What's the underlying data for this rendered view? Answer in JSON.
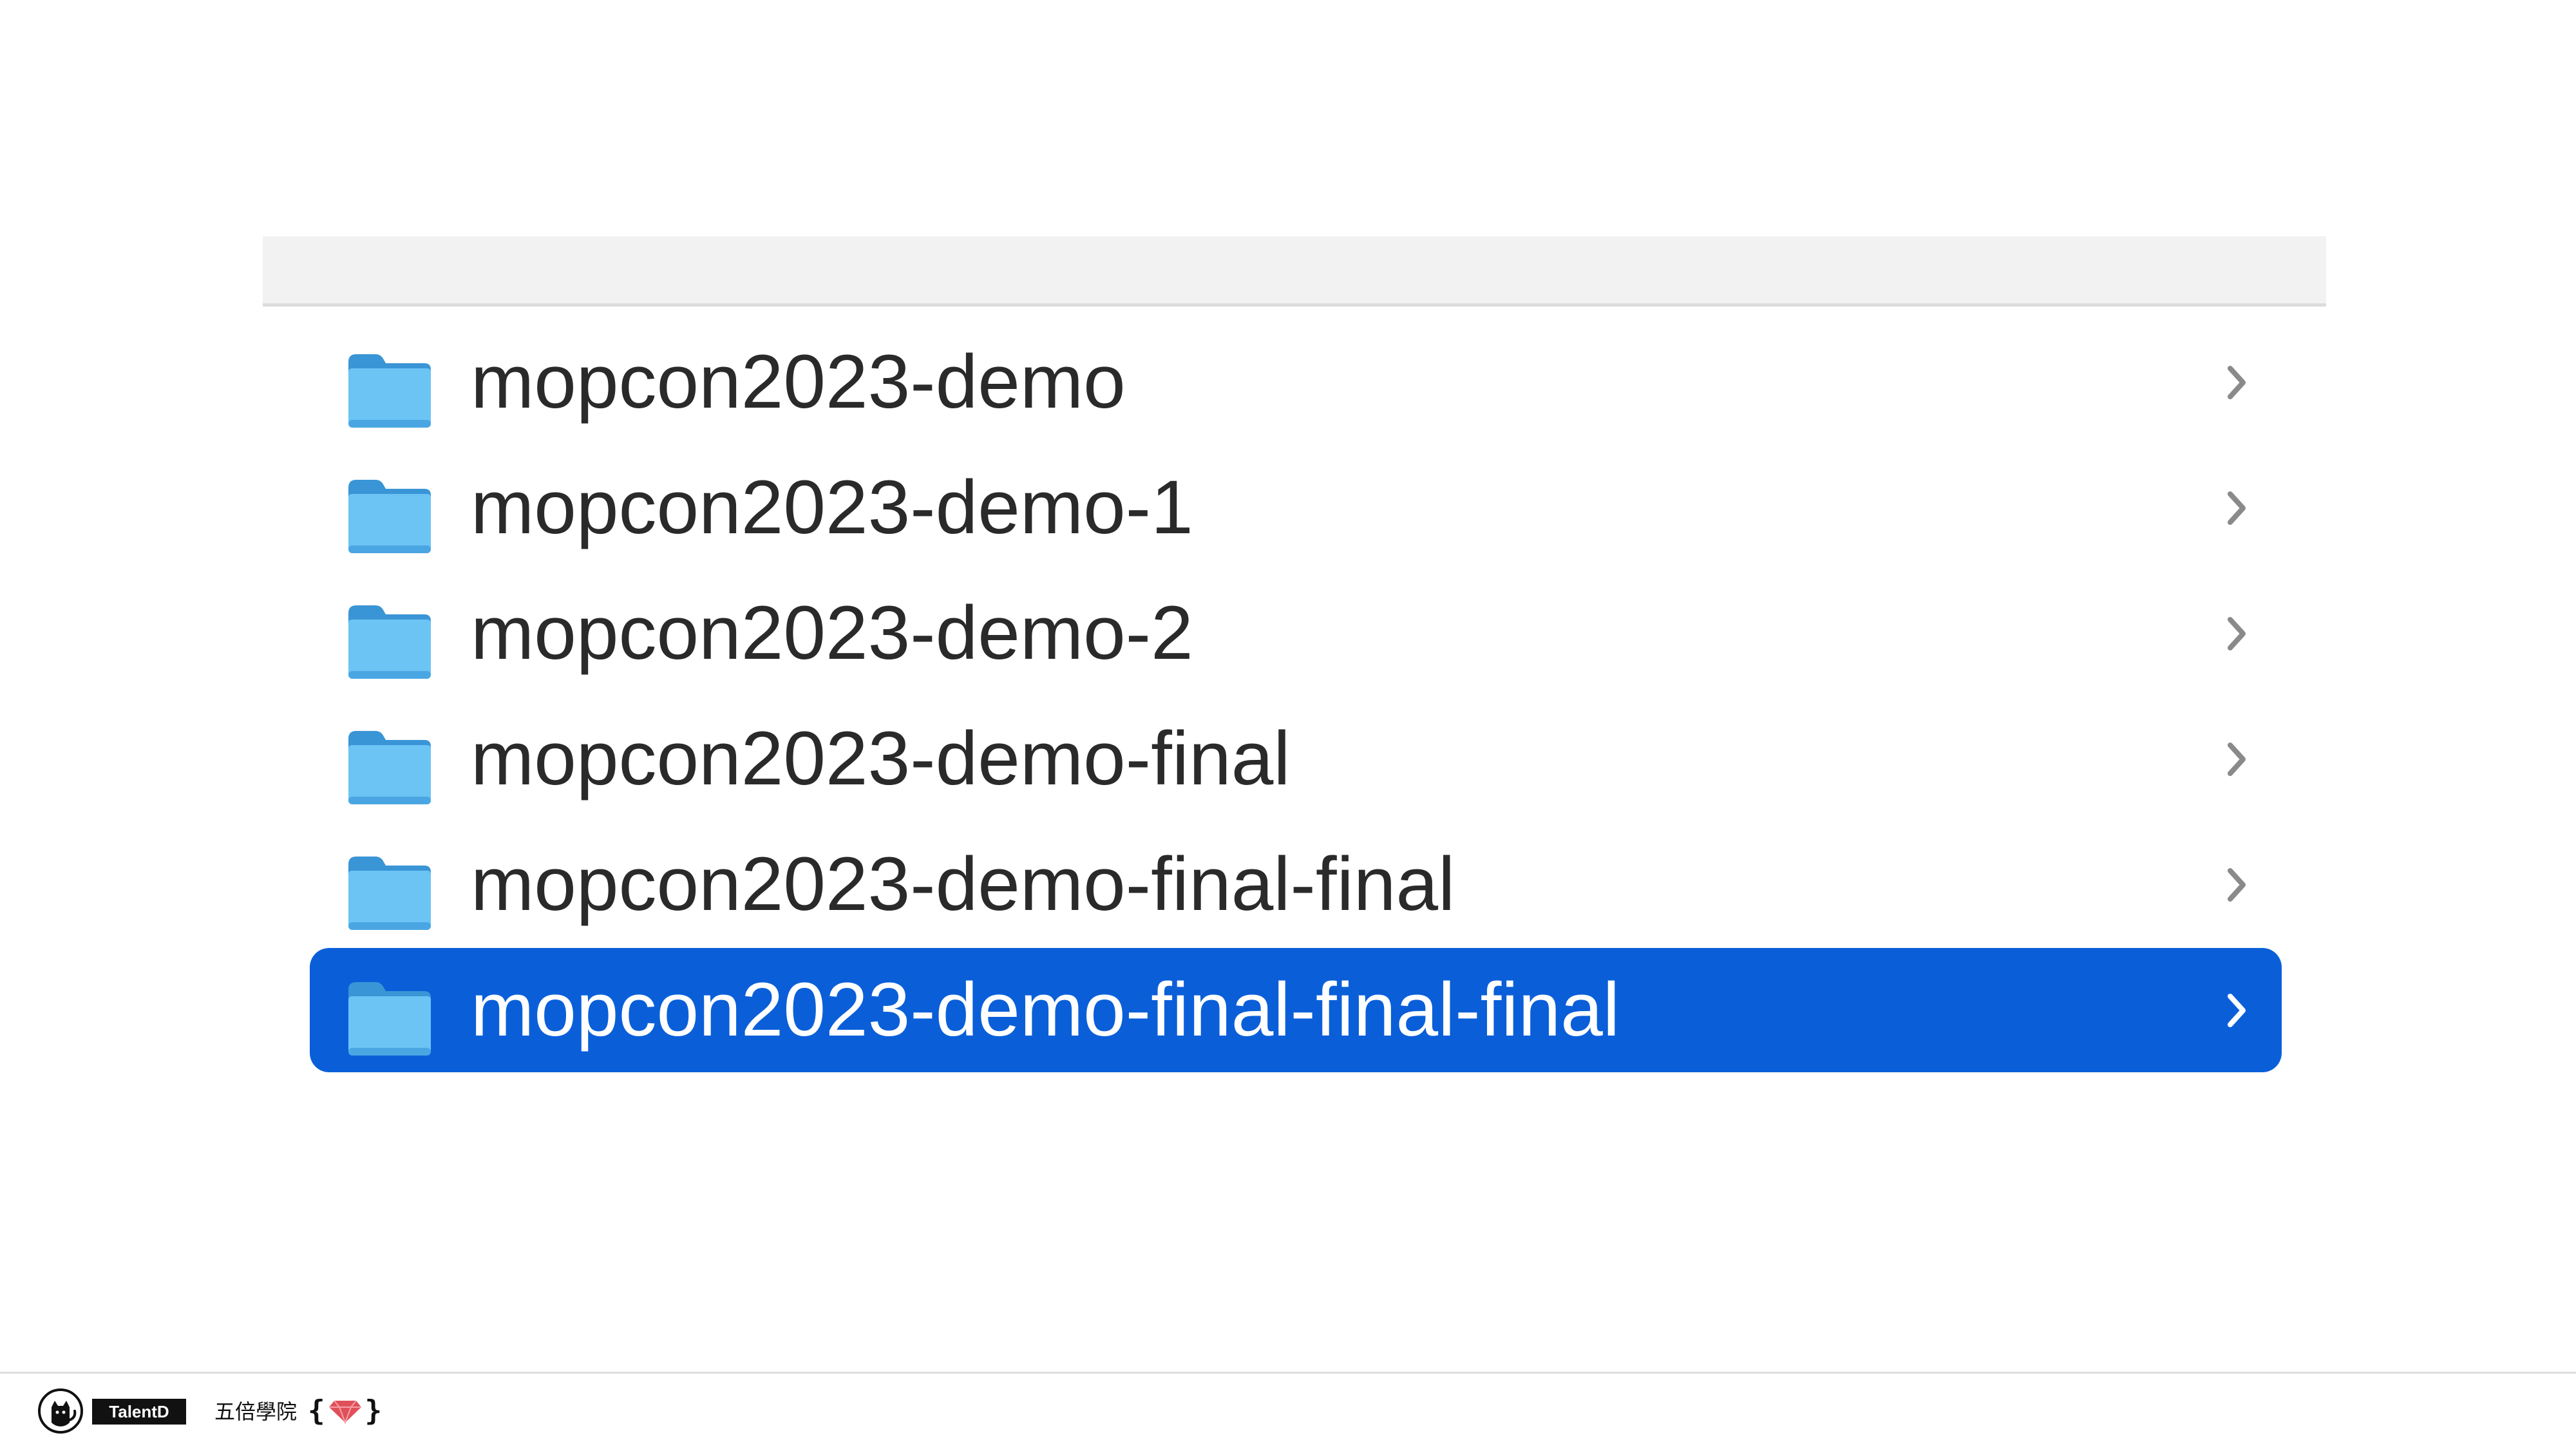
{
  "finder": {
    "items": [
      {
        "name": "mopcon2023-demo",
        "selected": false
      },
      {
        "name": "mopcon2023-demo-1",
        "selected": false
      },
      {
        "name": "mopcon2023-demo-2",
        "selected": false
      },
      {
        "name": "mopcon2023-demo-final",
        "selected": false
      },
      {
        "name": "mopcon2023-demo-final-final",
        "selected": false
      },
      {
        "name": "mopcon2023-demo-final-final-final",
        "selected": true
      }
    ],
    "item_icon": "folder-icon",
    "disclosure_icon": "chevron-right-icon"
  },
  "footer": {
    "badge_label": "TalentD",
    "school_name": "五倍學院",
    "brace_open": "{",
    "brace_close": "}"
  },
  "colors": {
    "selection": "#0a5fd9",
    "folder": "#5cb9f2",
    "text": "#2a2a2a",
    "gem": "#e0505a"
  }
}
